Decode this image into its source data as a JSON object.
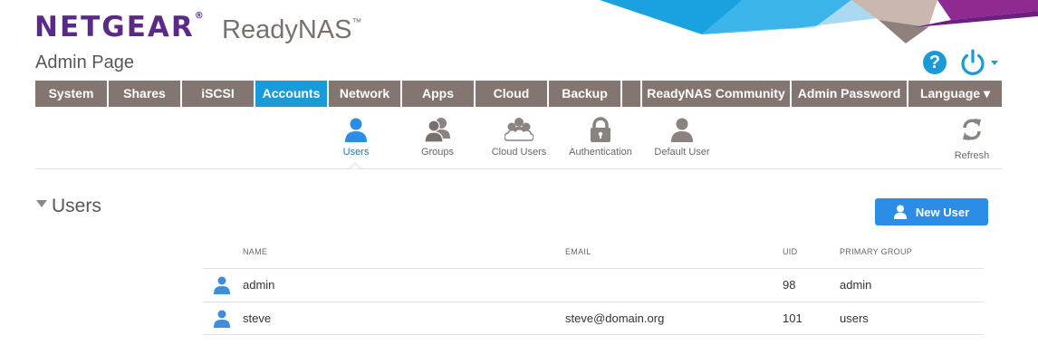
{
  "brand": {
    "logo": "NETGEAR",
    "logo_mark": "®",
    "product": "ReadyNAS",
    "product_mark": "™",
    "page_title": "Admin Page"
  },
  "header_icons": {
    "help": "?",
    "help_icon": "question-circle-icon",
    "power_icon": "power-icon"
  },
  "nav": {
    "items": [
      {
        "label": "System"
      },
      {
        "label": "Shares"
      },
      {
        "label": "iSCSI"
      },
      {
        "label": "Accounts",
        "active": true
      },
      {
        "label": "Network"
      },
      {
        "label": "Apps"
      },
      {
        "label": "Cloud"
      },
      {
        "label": "Backup"
      },
      {
        "label": ""
      },
      {
        "label": "ReadyNAS Community"
      },
      {
        "label": "Admin Password"
      },
      {
        "label": "Language ▾"
      }
    ]
  },
  "subnav": {
    "items": [
      {
        "label": "Users",
        "icon": "user-icon",
        "active": true
      },
      {
        "label": "Groups",
        "icon": "groups-icon"
      },
      {
        "label": "Cloud Users",
        "icon": "cloud-users-icon"
      },
      {
        "label": "Authentication",
        "icon": "lock-icon"
      },
      {
        "label": "Default User",
        "icon": "default-user-icon"
      }
    ],
    "refresh_label": "Refresh"
  },
  "users": {
    "title": "Users",
    "new_user_label": "New User",
    "columns": {
      "name": "NAME",
      "email": "EMAIL",
      "uid": "UID",
      "primary_group": "PRIMARY GROUP"
    },
    "rows": [
      {
        "name": "admin",
        "email": "",
        "uid": "98",
        "primary_group": "admin"
      },
      {
        "name": "steve",
        "email": "steve@domain.org",
        "uid": "101",
        "primary_group": "users"
      }
    ]
  },
  "colors": {
    "brand_purple": "#5b2a86",
    "nav_bg": "#837670",
    "accent_blue": "#1a9ad6",
    "button_blue": "#2b8de6",
    "user_icon_blue": "#3d8fdc"
  }
}
